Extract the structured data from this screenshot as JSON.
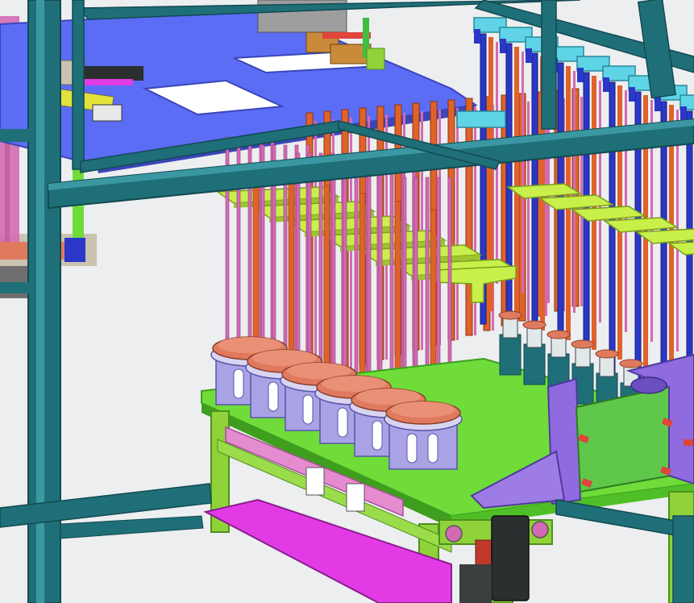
{
  "scene": {
    "kind": "cad-3d-assembly-render",
    "colors": {
      "background": "#e8eaed",
      "frame_teal": "#1f6f78",
      "frame_teal_dark": "#124a52",
      "frame_teal_light": "#3b98a2",
      "top_plate_blue": "#5b6cf5",
      "rod_orange": "#e0622a",
      "rod_pink": "#d46ab4",
      "rod_blue": "#2a37c7",
      "bracket_yellowgreen": "#c9f04a",
      "base_green": "#6fdc3a",
      "base_green_dark": "#3f9e1e",
      "holder_lavender": "#a9a3e6",
      "disc_salmon": "#e07a5f",
      "cap_cyan": "#5fd4e6",
      "side_plate_purple": "#8f6bdf",
      "tray_magenta": "#e23be6",
      "motor_dark": "#2b2f2f",
      "pipe_pink": "#e58bd0"
    }
  }
}
